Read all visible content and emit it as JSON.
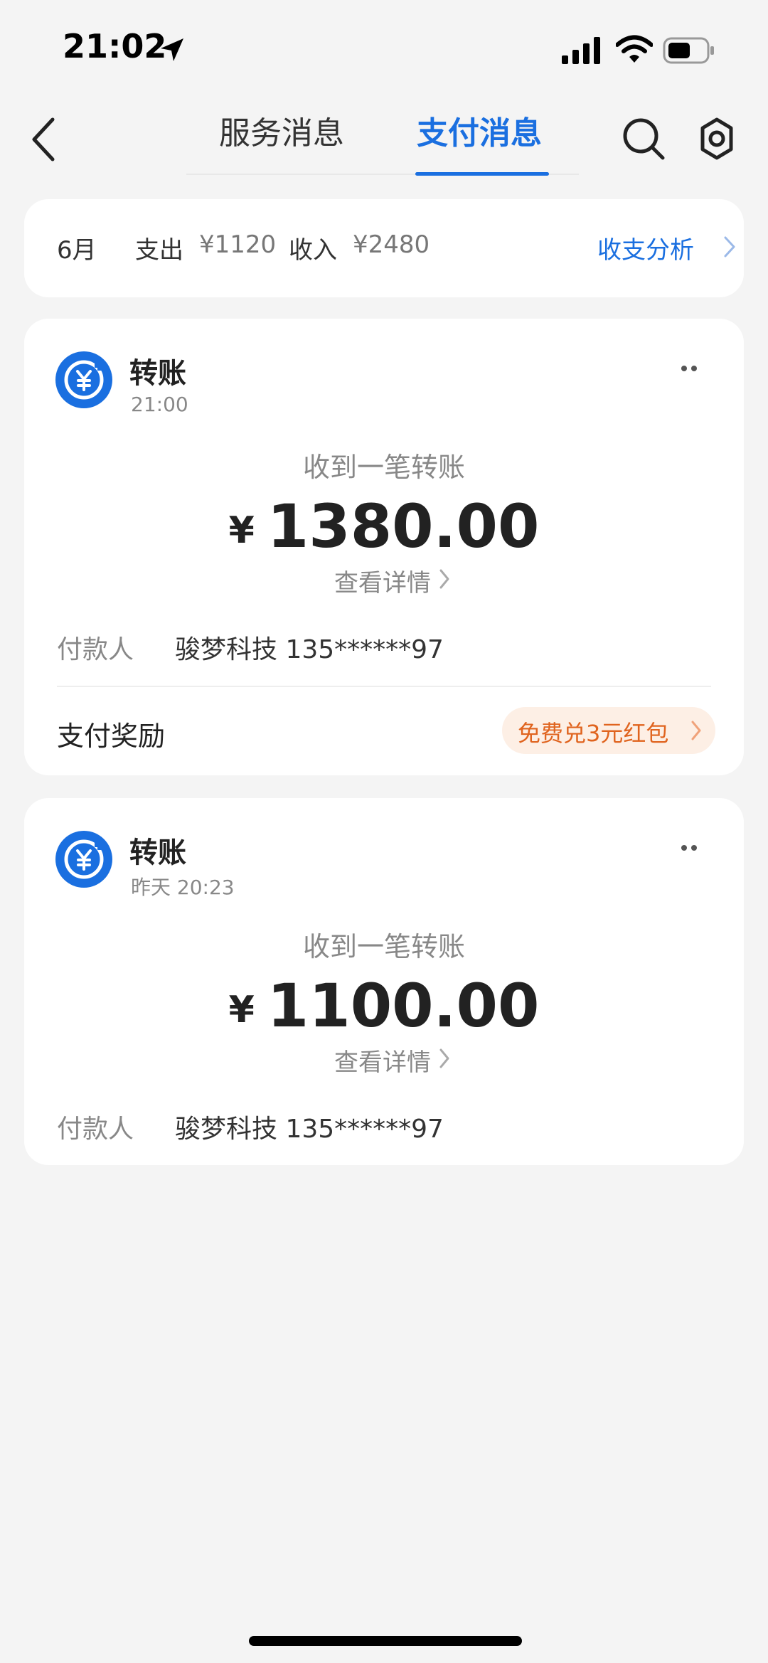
{
  "status_bar": {
    "time": "21:02",
    "icons": [
      "location-arrow-icon",
      "signal-icon",
      "wifi-icon",
      "battery-icon"
    ]
  },
  "header": {
    "back_icon": "back-chevron-icon",
    "tabs": [
      {
        "label": "服务消息",
        "active": false
      },
      {
        "label": "支付消息",
        "active": true
      }
    ],
    "search_icon": "search-icon",
    "settings_icon": "gear-icon"
  },
  "summary": {
    "month": "6月",
    "expense_label": "支出",
    "expense_value": "¥1120",
    "income_label": "收入",
    "income_value": "¥2480",
    "analysis_label": "收支分析"
  },
  "messages": [
    {
      "title": "转账",
      "time": "21:00",
      "subtitle": "收到一笔转账",
      "currency": "¥",
      "amount": "1380.00",
      "detail_label": "查看详情",
      "payer_label": "付款人",
      "payer_value": "骏梦科技 135******97",
      "reward_label": "支付奖励",
      "reward_action": "免费兑3元红包"
    },
    {
      "title": "转账",
      "time": "昨天 20:23",
      "subtitle": "收到一笔转账",
      "currency": "¥",
      "amount": "1100.00",
      "detail_label": "查看详情",
      "payer_label": "付款人",
      "payer_value": "骏梦科技 135******97"
    }
  ],
  "colors": {
    "accent": "#1a6fe0",
    "background": "#f4f4f4",
    "card": "#ffffff",
    "reward_text": "#e0641f",
    "reward_bg": "#fdefe5"
  }
}
